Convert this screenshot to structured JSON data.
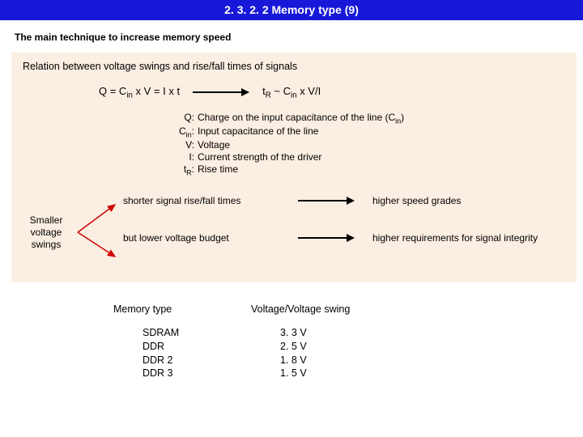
{
  "title": "2. 3. 2. 2 Memory type (9)",
  "subtitle": "The main technique to increase memory speed",
  "relation": "Relation between voltage swings  and rise/fall times of signals",
  "formula": {
    "left_pre": "Q = C",
    "left_sub": "in",
    "left_post": " x V = I x t",
    "right_pre": "t",
    "right_sub1": "R",
    "right_mid": " ~ C",
    "right_sub2": "in",
    "right_end": " x V/I"
  },
  "defs": [
    {
      "sym_pre": "Q",
      "sym_sub": "",
      "sym_post": ":",
      "desc_pre": "Charge on the input capacitance of the line (C",
      "desc_sub": "in",
      "desc_post": ")"
    },
    {
      "sym_pre": "C",
      "sym_sub": "in",
      "sym_post": ":",
      "desc_pre": "Input capacitance of the line",
      "desc_sub": "",
      "desc_post": ""
    },
    {
      "sym_pre": "V",
      "sym_sub": "",
      "sym_post": ":",
      "desc_pre": "Voltage",
      "desc_sub": "",
      "desc_post": ""
    },
    {
      "sym_pre": "I",
      "sym_sub": "",
      "sym_post": ":",
      "desc_pre": "Current strength of the driver",
      "desc_sub": "",
      "desc_post": ""
    },
    {
      "sym_pre": "t",
      "sym_sub": "R",
      "sym_post": ":",
      "desc_pre": "Rise time",
      "desc_sub": "",
      "desc_post": ""
    }
  ],
  "smaller": "Smaller voltage swings",
  "branch1_left": "shorter signal rise/fall times",
  "branch1_right": "higher speed grades",
  "branch2_left": "but lower voltage budget",
  "branch2_right": "higher requirements for signal integrity",
  "table": {
    "h1": "Memory type",
    "h2": "Voltage/Voltage swing",
    "rows": [
      {
        "type": "SDRAM",
        "volt": "3. 3 V"
      },
      {
        "type": "DDR",
        "volt": "2. 5 V"
      },
      {
        "type": "DDR 2",
        "volt": "1. 8 V"
      },
      {
        "type": "DDR 3",
        "volt": "1. 5 V"
      }
    ]
  }
}
